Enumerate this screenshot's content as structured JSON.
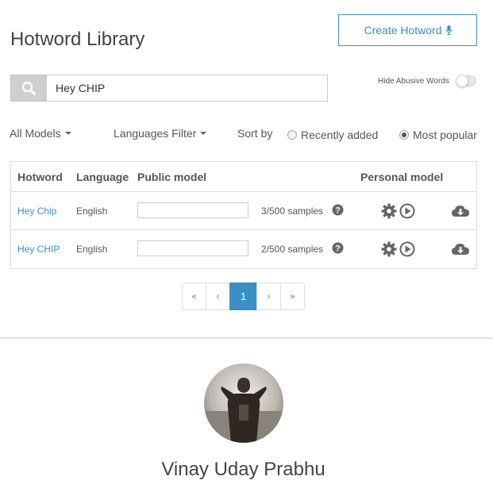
{
  "header": {
    "title": "Hotword Library",
    "create_button": "Create Hotword"
  },
  "search": {
    "value": "Hey CHIP"
  },
  "abusive_toggle": {
    "label": "Hide Abusive Words",
    "enabled": false
  },
  "filters": {
    "models": "All Models",
    "languages": "Languages Filter",
    "sort_label": "Sort by",
    "sort_options": [
      "Recently added",
      "Most popular"
    ],
    "sort_selected": "Most popular"
  },
  "table": {
    "headers": {
      "hotword": "Hotword",
      "language": "Language",
      "public_model": "Public model",
      "personal_model": "Personal model"
    },
    "rows": [
      {
        "hotword": "Hey Chip",
        "language": "English",
        "samples": "3/500 samples",
        "progress": 0.006
      },
      {
        "hotword": "Hey CHIP",
        "language": "English",
        "samples": "2/500 samples",
        "progress": 0.004
      }
    ]
  },
  "pagination": {
    "first": "«",
    "prev": "‹",
    "current": "1",
    "next": "›",
    "last": "»"
  },
  "profile": {
    "name": "Vinay Uday Prabhu"
  },
  "colors": {
    "accent": "#3a8fc6",
    "icon": "#666666"
  }
}
